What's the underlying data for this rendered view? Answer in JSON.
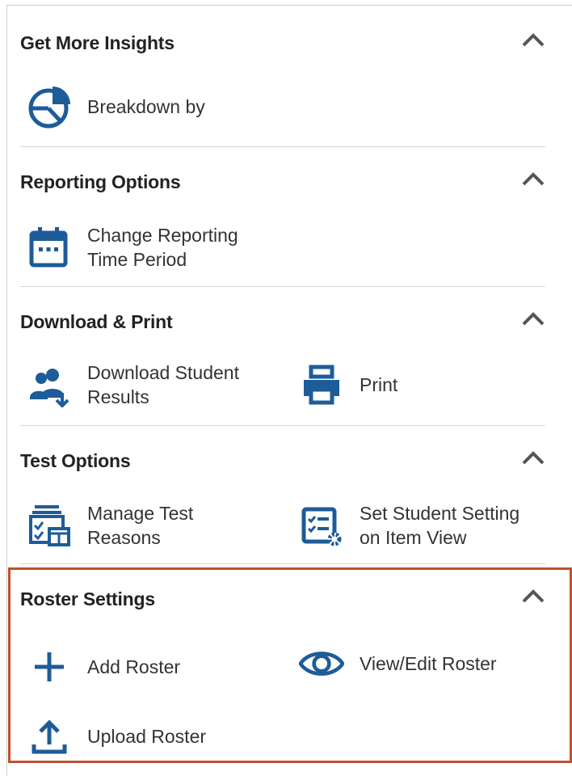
{
  "colors": {
    "accent": "#1d5c99",
    "highlight": "#c0502f",
    "divider": "#d6d6d6"
  },
  "sections": [
    {
      "title": "Get More Insights",
      "actions": [
        {
          "label": "Breakdown by",
          "icon": "pie-chart-icon"
        }
      ]
    },
    {
      "title": "Reporting Options",
      "actions": [
        {
          "label": "Change Reporting\nTime Period",
          "icon": "calendar-icon"
        }
      ]
    },
    {
      "title": "Download & Print",
      "actions": [
        {
          "label": "Download Student\nResults",
          "icon": "download-students-icon"
        },
        {
          "label": "Print",
          "icon": "printer-icon"
        }
      ]
    },
    {
      "title": "Test Options",
      "actions": [
        {
          "label": "Manage Test\nReasons",
          "icon": "manage-reasons-icon"
        },
        {
          "label": "Set Student Setting\non Item View",
          "icon": "checklist-settings-icon"
        }
      ]
    },
    {
      "title": "Roster Settings",
      "actions": [
        {
          "label": "Add Roster",
          "icon": "plus-icon"
        },
        {
          "label": "View/Edit Roster",
          "icon": "eye-icon"
        },
        {
          "label": "Upload Roster",
          "icon": "upload-icon"
        }
      ]
    }
  ]
}
